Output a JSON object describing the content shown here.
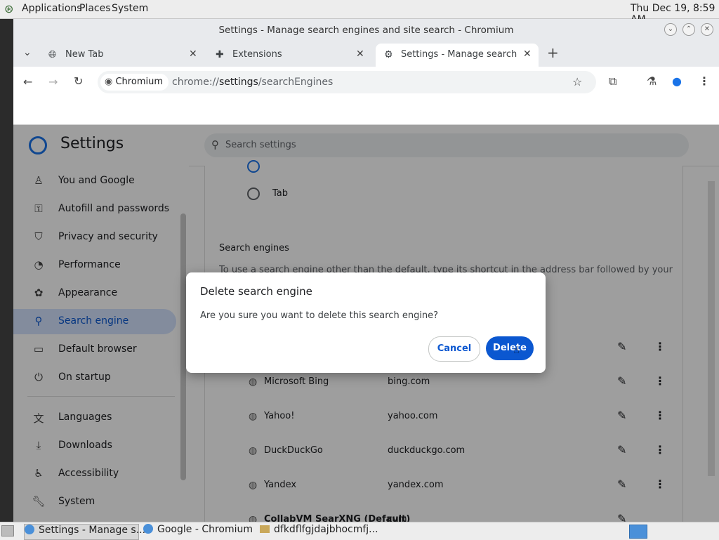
{
  "top_panel": {
    "menus": [
      "Applications",
      "Places",
      "System"
    ],
    "clock": "Thu Dec 19,  8:59 AM"
  },
  "window": {
    "title": "Settings - Manage search engines and site search - Chromium",
    "tabs": [
      {
        "label": "New Tab",
        "icon": "globe-icon"
      },
      {
        "label": "Extensions",
        "icon": "puzzle-icon"
      },
      {
        "label": "Settings - Manage search en",
        "icon": "gear-icon"
      }
    ]
  },
  "toolbar": {
    "chip_label": "Chromium",
    "url_prefix": "chrome://",
    "url_bold": "settings",
    "url_suffix": "/searchEngines"
  },
  "settings": {
    "title": "Settings",
    "search_placeholder": "Search settings",
    "nav": [
      {
        "label": "You and Google",
        "icon": "person-icon"
      },
      {
        "label": "Autofill and passwords",
        "icon": "key-icon"
      },
      {
        "label": "Privacy and security",
        "icon": "shield-icon"
      },
      {
        "label": "Performance",
        "icon": "gauge-icon"
      },
      {
        "label": "Appearance",
        "icon": "palette-icon"
      },
      {
        "label": "Search engine",
        "icon": "search-icon"
      },
      {
        "label": "Default browser",
        "icon": "browser-icon"
      },
      {
        "label": "On startup",
        "icon": "power-icon"
      },
      {
        "label": "Languages",
        "icon": "translate-icon"
      },
      {
        "label": "Downloads",
        "icon": "download-icon"
      },
      {
        "label": "Accessibility",
        "icon": "accessibility-icon"
      },
      {
        "label": "System",
        "icon": "wrench-icon"
      }
    ],
    "radio_option": "Tab",
    "section_title": "Search engines",
    "section_desc": "To use a search engine other than the default, type its shortcut in the address bar followed by your preferred",
    "engines": [
      {
        "name": "Microsoft Bing",
        "keyword": "bing.com"
      },
      {
        "name": "Yahoo!",
        "keyword": "yahoo.com"
      },
      {
        "name": "DuckDuckGo",
        "keyword": "duckduckgo.com"
      },
      {
        "name": "Yandex",
        "keyword": "yandex.com"
      },
      {
        "name": "CollabVM SearXNG (Default)",
        "keyword": "cvm"
      }
    ]
  },
  "dialog": {
    "title": "Delete search engine",
    "message": "Are you sure you want to delete this search engine?",
    "cancel_label": "Cancel",
    "delete_label": "Delete"
  },
  "taskbar": {
    "items": [
      "Settings - Manage s...",
      "Google - Chromium",
      "dfkdflfgjdajbhocmfj..."
    ]
  }
}
